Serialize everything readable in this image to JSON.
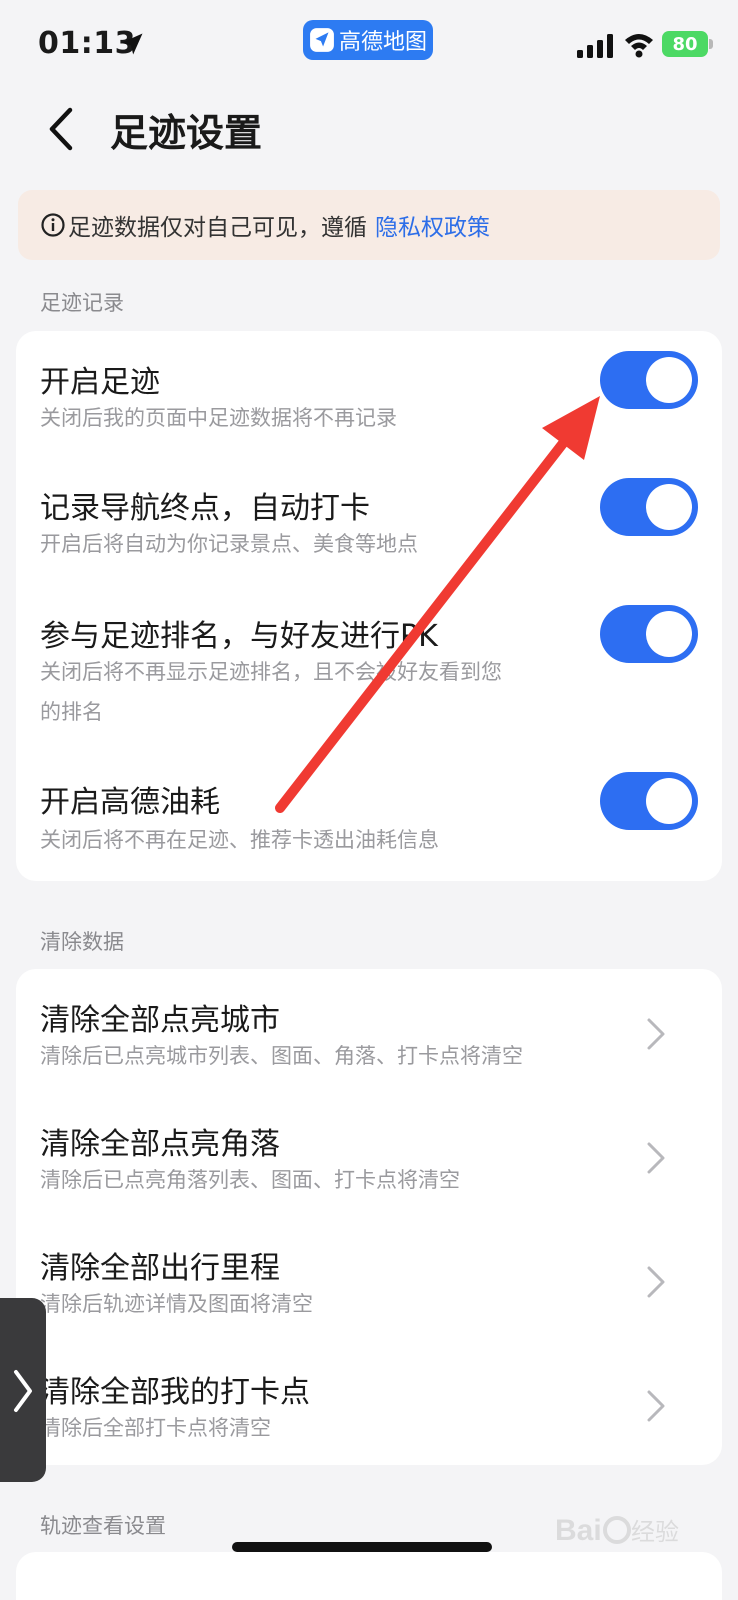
{
  "status_bar": {
    "time": "01:13",
    "app_name": "高德地图",
    "battery": "80",
    "accent": "#2d7bf2",
    "battery_color": "#4cd964"
  },
  "header": {
    "title": "足迹设置",
    "back_icon": "chevron-left-icon"
  },
  "notice": {
    "text": "足迹数据仅对自己可见，遵循",
    "link": "隐私权政策",
    "background": "#f7ebe4",
    "link_color": "#2d6ee8"
  },
  "sections": {
    "footprint": {
      "label": "足迹记录",
      "items": [
        {
          "title": "开启足迹",
          "subtitle": "关闭后我的页面中足迹数据将不再记录",
          "enabled": true
        },
        {
          "title": "记录导航终点，自动打卡",
          "subtitle": "开启后将自动为你记录景点、美食等地点",
          "enabled": true
        },
        {
          "title": "参与足迹排名，与好友进行PK",
          "subtitle": "关闭后将不再显示足迹排名，且不会被好友看到您的排名",
          "enabled": true
        },
        {
          "title": "开启高德油耗",
          "subtitle": "关闭后将不再在足迹、推荐卡透出油耗信息",
          "enabled": true
        }
      ]
    },
    "clear": {
      "label": "清除数据",
      "items": [
        {
          "title": "清除全部点亮城市",
          "subtitle": "清除后已点亮城市列表、图面、角落、打卡点将清空"
        },
        {
          "title": "清除全部点亮角落",
          "subtitle": "清除后已点亮角落列表、图面、打卡点将清空"
        },
        {
          "title": "清除全部出行里程",
          "subtitle": "清除后轨迹详情及图面将清空"
        },
        {
          "title": "清除全部我的打卡点",
          "subtitle": "清除后全部打卡点将清空"
        }
      ]
    },
    "track": {
      "label": "轨迹查看设置"
    }
  },
  "toggle_color": "#2d6ef2",
  "annotation_arrow_color": "#f03a32",
  "watermark": "Baidu经验"
}
